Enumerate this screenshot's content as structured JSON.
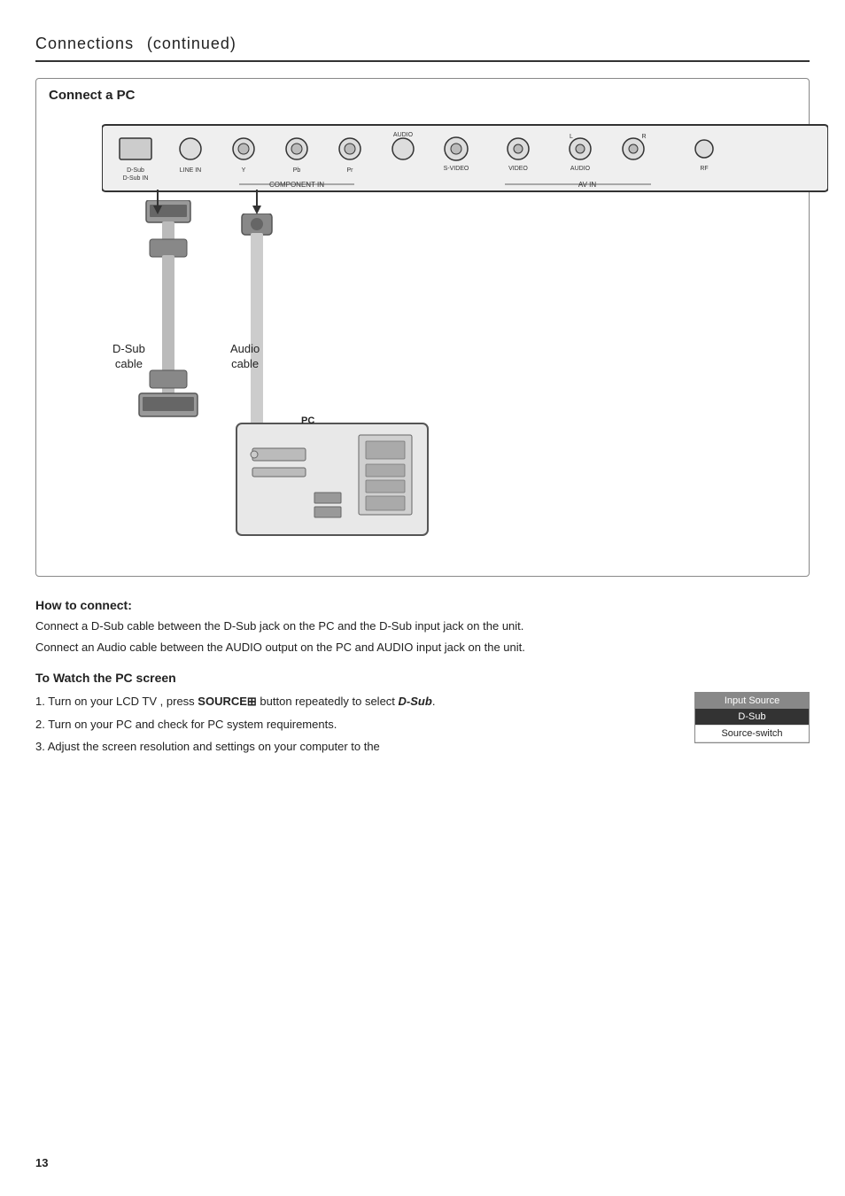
{
  "page": {
    "title": "Connections",
    "subtitle": "(continued)",
    "page_number": "13"
  },
  "section": {
    "title": "Connect a PC"
  },
  "tv_panel": {
    "ports": [
      {
        "id": "dsub",
        "label": "D-Sub",
        "label2": "D-Sub IN"
      },
      {
        "id": "line_in",
        "label": "LINE IN"
      },
      {
        "id": "Y",
        "label": "Y"
      },
      {
        "id": "Pb",
        "label": "Pb"
      },
      {
        "id": "Pr",
        "label": "Pr"
      },
      {
        "id": "audio",
        "label": "AUDIO"
      },
      {
        "id": "svideo",
        "label": "S-VIDEO"
      },
      {
        "id": "video",
        "label": "VIDEO"
      },
      {
        "id": "av_audio_l",
        "label": "L"
      },
      {
        "id": "av_audio_r",
        "label": "R"
      },
      {
        "id": "rf",
        "label": "RF"
      }
    ],
    "component_in_label": "COMPONENT IN",
    "av_in_label": "AV IN"
  },
  "cables": {
    "dsub": {
      "name": "D-Sub\ncable"
    },
    "audio": {
      "name": "Audio\ncable"
    },
    "pc_label": "PC"
  },
  "how_to_connect": {
    "heading": "How to connect:",
    "text1": "Connect a D-Sub cable between the D-Sub  jack on the PC and the D-Sub input jack on the unit.",
    "text2": "Connect an Audio cable between  the AUDIO output on the PC and AUDIO input jack on the unit."
  },
  "watch_pc": {
    "heading": "To Watch the PC screen",
    "steps": [
      "1. Turn on your LCD TV , press SOURCE⊞ button repeatedly to select D-Sub.",
      "2. Turn on your PC and check for PC system requirements.",
      "3. Adjust the screen resolution and settings on your computer to the"
    ],
    "step1_bold": "D-Sub"
  },
  "source_menu": {
    "header": "Input Source",
    "items": [
      "D-Sub",
      "Source-switch"
    ],
    "selected": "D-Sub"
  }
}
